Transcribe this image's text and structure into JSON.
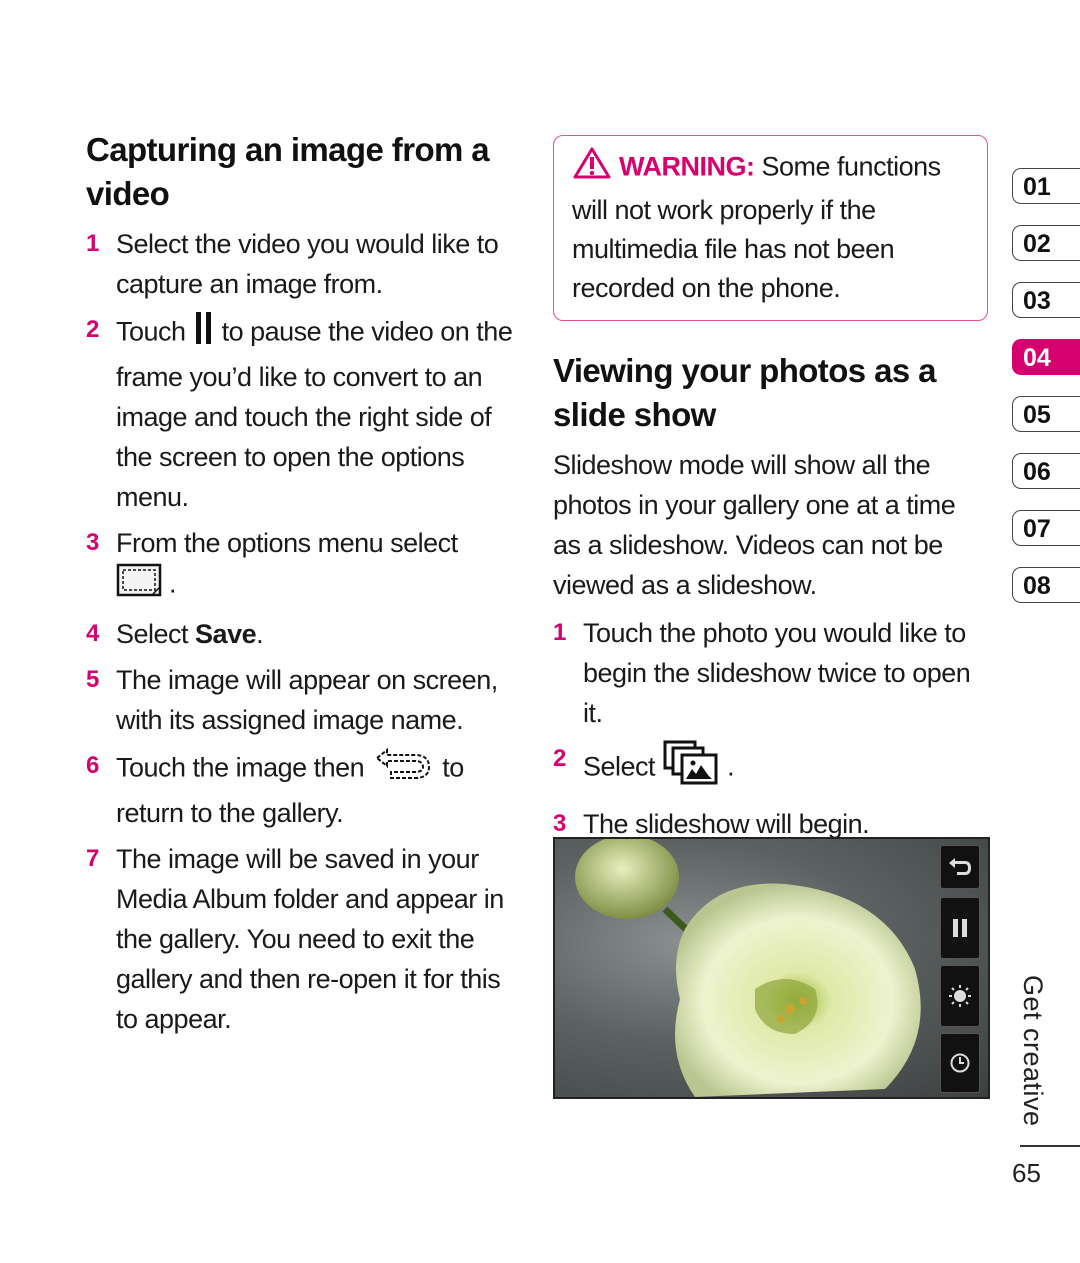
{
  "left_section": {
    "title": "Capturing an image from a video",
    "steps": [
      {
        "num": "1",
        "text": "Select the video you would like to capture an image from."
      },
      {
        "num": "2",
        "before": "Touch",
        "icon": "pause-icon",
        "after": "to pause the video on the frame you’d like to convert to an image and touch the right side of the screen to open the options menu."
      },
      {
        "num": "3",
        "before": "From the options menu select",
        "icon": "capture-frame-icon",
        "after": "."
      },
      {
        "num": "4",
        "before": "Select ",
        "bold": "Save",
        "after": "."
      },
      {
        "num": "5",
        "text": "The image will appear on screen, with its assigned image name."
      },
      {
        "num": "6",
        "before": "Touch the image then",
        "icon": "back-arrow-icon",
        "after": "to return to the gallery."
      },
      {
        "num": "7",
        "text": "The image will be saved in your Media Album folder and appear in the gallery. You need to exit the gallery and then re-open it for this to appear."
      }
    ]
  },
  "warning": {
    "icon": "warning-triangle-icon",
    "label": "WARNING:",
    "text": " Some functions will not work properly if the multimedia file has not been recorded on the phone."
  },
  "right_section": {
    "title": "Viewing your photos as a slide show",
    "intro": "Slideshow mode will show all the photos in your gallery one at a time as a slideshow. Videos can not be viewed as a slideshow.",
    "steps": [
      {
        "num": "1",
        "text": "Touch the photo you would like to begin the slideshow twice to open it."
      },
      {
        "num": "2",
        "before": "Select",
        "icon": "slideshow-icon",
        "after": "."
      },
      {
        "num": "3",
        "text": "The slideshow will begin."
      }
    ]
  },
  "screenshot": {
    "description": "White flower slideshow photo",
    "controls": [
      "back-icon",
      "pause-icon",
      "brightness-icon",
      "timer-icon"
    ]
  },
  "chapter_tabs": [
    "01",
    "02",
    "03",
    "04",
    "05",
    "06",
    "07",
    "08"
  ],
  "active_chapter": "04",
  "side_label": "Get creative",
  "page_number": "65",
  "colors": {
    "accent": "#d6006f",
    "warning_border": "#e0509e"
  }
}
